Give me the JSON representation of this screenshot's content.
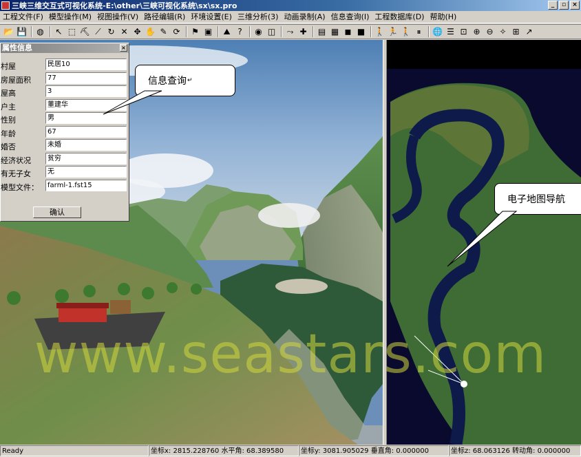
{
  "window": {
    "title": "三峡三维交互式可视化系统-E:\\other\\三峡可视化系统\\sx\\sx.pro",
    "app_icon": "app-icon",
    "minimize_icon": "_",
    "maximize_icon": "▫",
    "close_icon": "×"
  },
  "menu": [
    "工程文件(F)",
    "模型操作(M)",
    "视图操作(V)",
    "路径编辑(R)",
    "环境设置(E)",
    "三维分析(3)",
    "动画录制(A)",
    "信息查询(I)",
    "工程数据库(D)",
    "帮助(H)"
  ],
  "toolbar": [
    {
      "icon": "open-folder-icon",
      "glyph": "📂"
    },
    {
      "icon": "save-icon",
      "glyph": "💾"
    },
    {
      "sep": true
    },
    {
      "icon": "globe-icon",
      "glyph": "◍"
    },
    {
      "sep": true
    },
    {
      "icon": "pointer-icon",
      "glyph": "↖"
    },
    {
      "icon": "select-icon",
      "glyph": "⬚"
    },
    {
      "icon": "pick-icon",
      "glyph": "⛏"
    },
    {
      "icon": "ruler-icon",
      "glyph": "⟋"
    },
    {
      "icon": "rotate-icon",
      "glyph": "↻"
    },
    {
      "icon": "delete-icon",
      "glyph": "✕"
    },
    {
      "icon": "move-icon",
      "glyph": "✥"
    },
    {
      "icon": "grab-icon",
      "glyph": "✋"
    },
    {
      "icon": "edit-icon",
      "glyph": "✎"
    },
    {
      "icon": "refresh-icon",
      "glyph": "⟳"
    },
    {
      "sep": true
    },
    {
      "icon": "flag-icon",
      "glyph": "⚑"
    },
    {
      "icon": "camera-icon",
      "glyph": "▣"
    },
    {
      "sep": true
    },
    {
      "icon": "terrain-icon",
      "glyph": "⛰"
    },
    {
      "icon": "help-query-icon",
      "glyph": "?"
    },
    {
      "sep": true
    },
    {
      "icon": "eye-icon",
      "glyph": "◉"
    },
    {
      "icon": "cube-icon",
      "glyph": "◫"
    },
    {
      "sep": true
    },
    {
      "icon": "path-icon",
      "glyph": "⤳"
    },
    {
      "icon": "add-point-icon",
      "glyph": "✚"
    },
    {
      "sep": true
    },
    {
      "icon": "film-icon",
      "glyph": "▤"
    },
    {
      "icon": "page-icon",
      "glyph": "▦"
    },
    {
      "icon": "record-icon",
      "glyph": "◼"
    },
    {
      "icon": "stop-icon",
      "glyph": "■"
    },
    {
      "sep": true
    },
    {
      "icon": "walk-icon",
      "glyph": "🚶"
    },
    {
      "icon": "run-icon",
      "glyph": "🏃"
    },
    {
      "icon": "walk-fast-icon",
      "glyph": "🚶"
    },
    {
      "icon": "pause-icon",
      "glyph": "⏸"
    },
    {
      "sep": true
    },
    {
      "icon": "earth-icon",
      "glyph": "🌐"
    },
    {
      "icon": "layers-icon",
      "glyph": "☰"
    },
    {
      "icon": "zoom-window-icon",
      "glyph": "⊡"
    },
    {
      "icon": "zoom-in-icon",
      "glyph": "⊕"
    },
    {
      "icon": "zoom-out-icon",
      "glyph": "⊖"
    },
    {
      "icon": "pan-icon",
      "glyph": "✧"
    },
    {
      "icon": "zoom-all-icon",
      "glyph": "⊞"
    },
    {
      "icon": "arrow-tool-icon",
      "glyph": "↗"
    }
  ],
  "props": {
    "title": "属性信息",
    "rows": [
      {
        "label": "村屋",
        "value": "民居10"
      },
      {
        "label": "房屋面积",
        "value": "77"
      },
      {
        "label": "屋高",
        "value": "3"
      },
      {
        "label": "户主",
        "value": "董建华"
      },
      {
        "label": "性别",
        "value": "男"
      },
      {
        "label": "年龄",
        "value": "67"
      },
      {
        "label": "婚否",
        "value": "未婚"
      },
      {
        "label": "经济状况",
        "value": "贫穷"
      },
      {
        "label": "有无子女",
        "value": "无"
      },
      {
        "label": "模型文件：",
        "value": "farml-1.fst15"
      }
    ],
    "ok": "确认"
  },
  "callouts": {
    "info": "信息查询",
    "info_mark": "↵",
    "map": "电子地图导航"
  },
  "watermark": "www.seastars.com",
  "status": {
    "ready": "Ready",
    "x": "坐标x: 2815.228760 水平角: 68.389580",
    "y": "坐标y: 3081.905029 垂直角: 0.000000",
    "z": "坐标z: 68.063126 转动角: 0.000000"
  }
}
